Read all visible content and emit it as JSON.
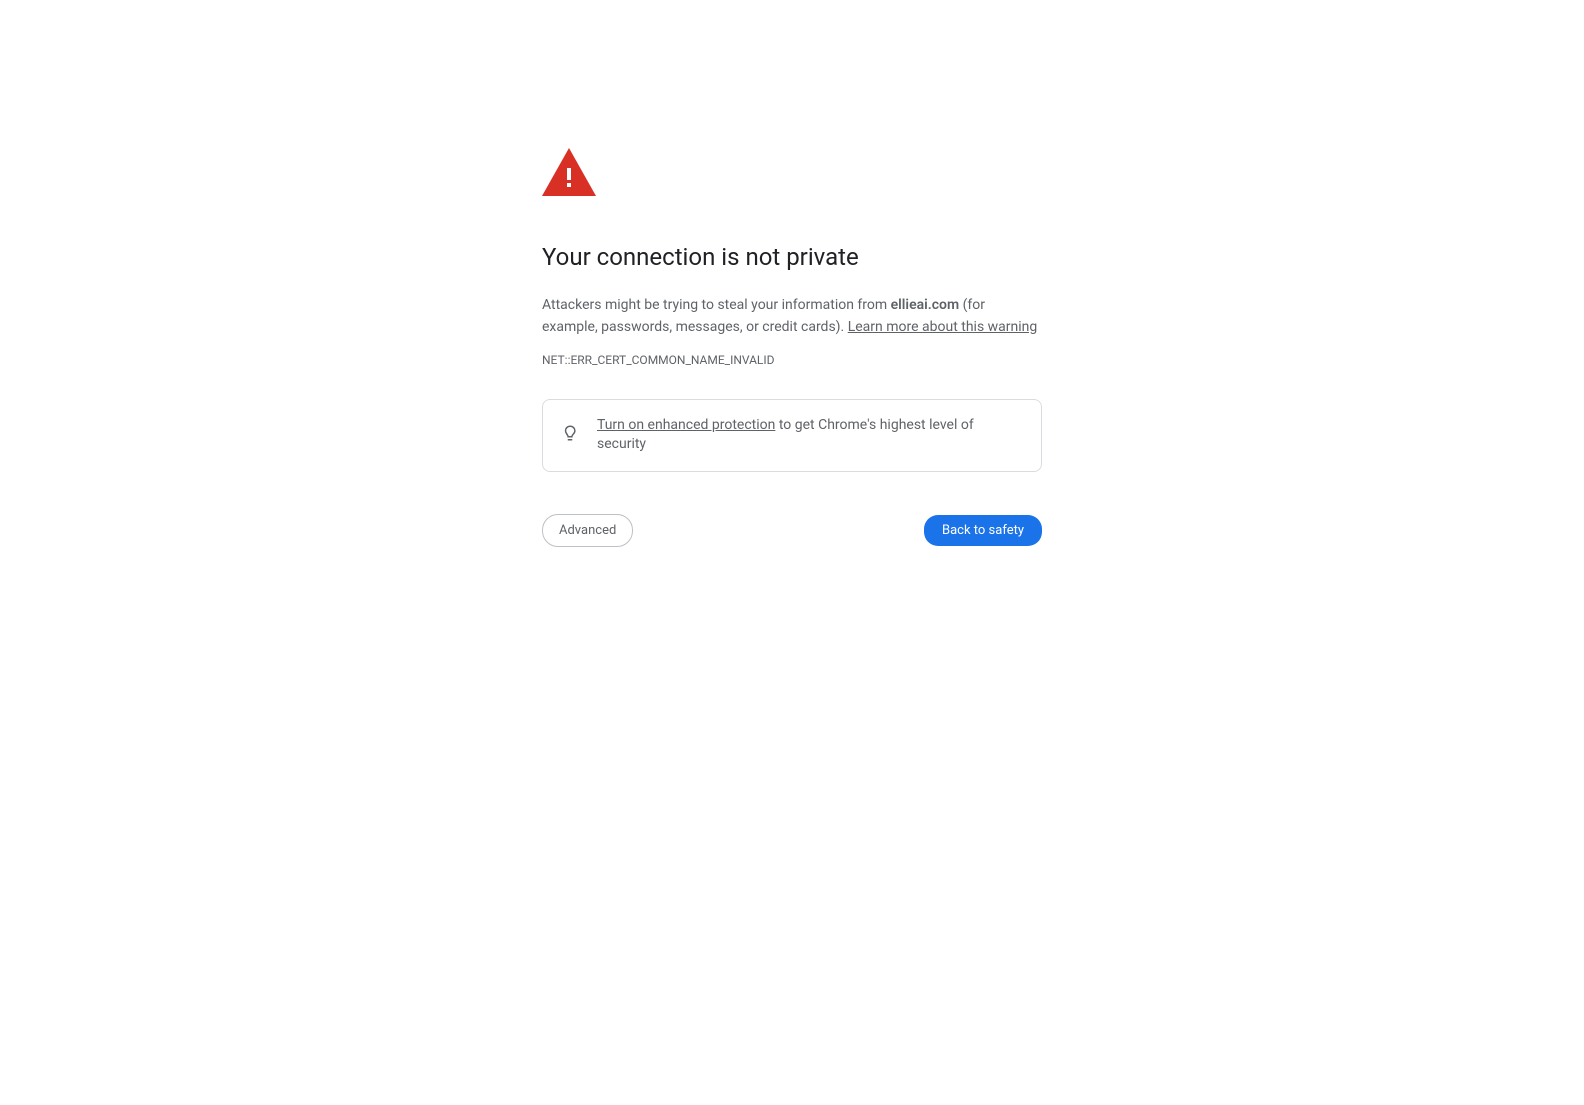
{
  "title": "Your connection is not private",
  "description": {
    "prefix": "Attackers might be trying to steal your information from ",
    "domain": "ellieai.com",
    "suffix": " (for example, passwords, messages, or credit cards). ",
    "learn_more": "Learn more about this warning"
  },
  "error_code": "NET::ERR_CERT_COMMON_NAME_INVALID",
  "tip": {
    "link_text": "Turn on enhanced protection",
    "suffix": " to get Chrome's highest level of security"
  },
  "buttons": {
    "advanced": "Advanced",
    "back_to_safety": "Back to safety"
  },
  "colors": {
    "warning_red": "#d93025",
    "primary_blue": "#1a73e8",
    "text_gray": "#5f6368"
  }
}
